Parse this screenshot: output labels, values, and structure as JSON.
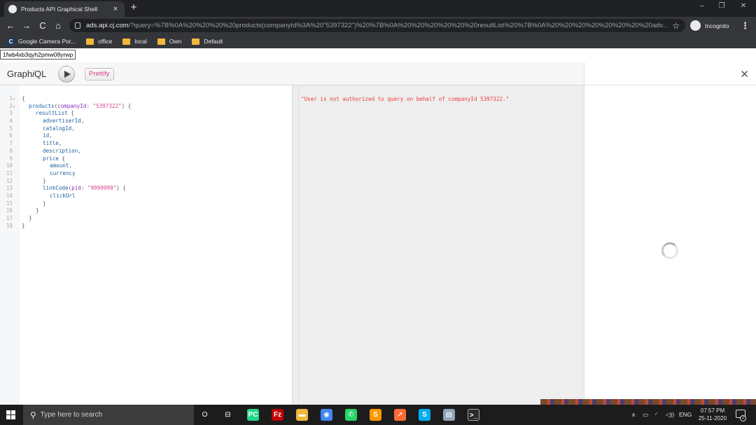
{
  "browser": {
    "tab_title": "Products API Graphical Shell",
    "tab_close": "×",
    "new_tab": "+",
    "window_controls": {
      "minimize": "–",
      "maximize": "❐",
      "close": "✕"
    },
    "nav": {
      "back": "←",
      "forward": "→",
      "reload": "C",
      "home": "⌂"
    },
    "url_host": "ads.api.cj.com",
    "url_rest": "/?query=%7B%0A%20%20%20%20products(companyId%3A%20\"5397322\")%20%7B%0A%20%20%20%20%20%20resultList%20%7B%0A%20%20%20%20%20%20%20%20adv...",
    "star": "☆",
    "incognito_label": "Incognito",
    "menu": "⋮",
    "bookmarks": [
      {
        "label": "Google Camera Por...",
        "icon": "cj-icon"
      },
      {
        "label": "office",
        "icon": "folder-icon"
      },
      {
        "label": "local",
        "icon": "folder-icon"
      },
      {
        "label": "Own",
        "icon": "folder-icon"
      },
      {
        "label": "Default",
        "icon": "folder-icon"
      }
    ],
    "cj_icon_letter": "C"
  },
  "tooltip": "1fwb4xb3qyh2pmw08yrwp",
  "graphiql": {
    "title_prefix": "Graph",
    "title_italic": "i",
    "title_suffix": "QL",
    "prettify_label": "Prettify",
    "docs_close": "✕",
    "query_lines": [
      {
        "n": "1",
        "fold": true,
        "indent": 0,
        "parts": [
          [
            "punc",
            "{"
          ]
        ]
      },
      {
        "n": "2",
        "fold": true,
        "indent": 2,
        "parts": [
          [
            "field",
            "products"
          ],
          [
            "punc",
            "("
          ],
          [
            "def",
            "companyId"
          ],
          [
            "punc",
            ": "
          ],
          [
            "str",
            "\"5397322\""
          ],
          [
            "punc",
            ") {"
          ]
        ]
      },
      {
        "n": "3",
        "fold": false,
        "indent": 4,
        "parts": [
          [
            "field",
            "resultList"
          ],
          [
            "punc",
            " {"
          ]
        ]
      },
      {
        "n": "4",
        "fold": false,
        "indent": 6,
        "parts": [
          [
            "field",
            "advertiserId"
          ],
          [
            "punc",
            ","
          ]
        ]
      },
      {
        "n": "5",
        "fold": false,
        "indent": 6,
        "parts": [
          [
            "field",
            "catalogId"
          ],
          [
            "punc",
            ","
          ]
        ]
      },
      {
        "n": "6",
        "fold": false,
        "indent": 6,
        "parts": [
          [
            "field",
            "id"
          ],
          [
            "punc",
            ","
          ]
        ]
      },
      {
        "n": "7",
        "fold": false,
        "indent": 6,
        "parts": [
          [
            "field",
            "title"
          ],
          [
            "punc",
            ","
          ]
        ]
      },
      {
        "n": "8",
        "fold": false,
        "indent": 6,
        "parts": [
          [
            "field",
            "description"
          ],
          [
            "punc",
            ","
          ]
        ]
      },
      {
        "n": "9",
        "fold": false,
        "indent": 6,
        "parts": [
          [
            "field",
            "price"
          ],
          [
            "punc",
            " {"
          ]
        ]
      },
      {
        "n": "10",
        "fold": false,
        "indent": 8,
        "parts": [
          [
            "field",
            "amount"
          ],
          [
            "punc",
            ","
          ]
        ]
      },
      {
        "n": "11",
        "fold": false,
        "indent": 8,
        "parts": [
          [
            "field",
            "currency"
          ]
        ]
      },
      {
        "n": "12",
        "fold": false,
        "indent": 6,
        "parts": [
          [
            "punc",
            "}"
          ]
        ]
      },
      {
        "n": "13",
        "fold": false,
        "indent": 6,
        "parts": [
          [
            "field",
            "linkCode"
          ],
          [
            "punc",
            "("
          ],
          [
            "def",
            "pid"
          ],
          [
            "punc",
            ": "
          ],
          [
            "str",
            "\"9999999\""
          ],
          [
            "punc",
            ") {"
          ]
        ]
      },
      {
        "n": "14",
        "fold": false,
        "indent": 8,
        "parts": [
          [
            "field",
            "clickUrl"
          ]
        ]
      },
      {
        "n": "15",
        "fold": false,
        "indent": 6,
        "parts": [
          [
            "punc",
            "}"
          ]
        ]
      },
      {
        "n": "16",
        "fold": false,
        "indent": 4,
        "parts": [
          [
            "punc",
            "}"
          ]
        ]
      },
      {
        "n": "17",
        "fold": false,
        "indent": 2,
        "parts": [
          [
            "punc",
            "}"
          ]
        ]
      },
      {
        "n": "18",
        "fold": false,
        "indent": 0,
        "parts": [
          [
            "punc",
            "}"
          ]
        ]
      }
    ],
    "result_text": "\"User is not authorized to query on behalf of companyId 5397322.\""
  },
  "taskbar": {
    "search_placeholder": "Type here to search",
    "search_glyph": "⚲",
    "cortana_glyph": "O",
    "taskview_glyph": "⊟",
    "apps": [
      {
        "name": "pycharm-icon",
        "glyph": "PC",
        "color": "#21d789"
      },
      {
        "name": "filezilla-icon",
        "glyph": "Fz",
        "color": "#bf0000"
      },
      {
        "name": "file-explorer-icon",
        "glyph": "▬",
        "color": "#f2b83b"
      },
      {
        "name": "chrome-icon",
        "glyph": "◉",
        "color": "#4285f4"
      },
      {
        "name": "whatsapp-icon",
        "glyph": "✆",
        "color": "#25d366"
      },
      {
        "name": "sublime-icon",
        "glyph": "S",
        "color": "#ff9800"
      },
      {
        "name": "postman-icon",
        "glyph": "➚",
        "color": "#ff6c37"
      },
      {
        "name": "skype-icon",
        "glyph": "S",
        "color": "#00aff0"
      },
      {
        "name": "printer-icon",
        "glyph": "▤",
        "color": "#8fa4b8"
      },
      {
        "name": "terminal-icon",
        "glyph": ">_",
        "color": "#2b2b2b"
      }
    ],
    "tray_chevron": "∧",
    "tray_battery": "▭",
    "tray_wifi": "◜",
    "tray_volume": "◁))",
    "language": "ENG",
    "time": "07:57 PM",
    "date": "25-11-2020",
    "notification_count": "2"
  }
}
